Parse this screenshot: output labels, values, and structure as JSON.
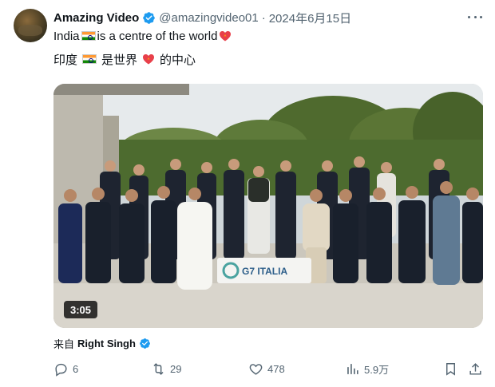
{
  "post": {
    "author_name": "Amazing Video",
    "handle": "@amazingvideo01",
    "separator": "·",
    "date": "2024年6月15日",
    "line1_a": "India",
    "line1_b": "is a centre of the world",
    "line2_a": "印度",
    "line2_b": "是世界",
    "line2_c": "的中心"
  },
  "video": {
    "duration": "3:05",
    "banner_text": "G7 ITALIA"
  },
  "source": {
    "prefix": "来自",
    "name": "Right Singh"
  },
  "actions": {
    "replies": "6",
    "reposts": "29",
    "likes": "478",
    "views": "5.9万"
  },
  "colors": {
    "verified": "#1d9bf0",
    "secondary_text": "#536471",
    "primary_text": "#0f1419"
  },
  "icons": [
    "verified-badge-icon",
    "more-icon",
    "india-flag-icon",
    "heart-emoji-icon",
    "reply-icon",
    "repost-icon",
    "like-icon",
    "views-icon",
    "bookmark-icon",
    "share-icon"
  ]
}
